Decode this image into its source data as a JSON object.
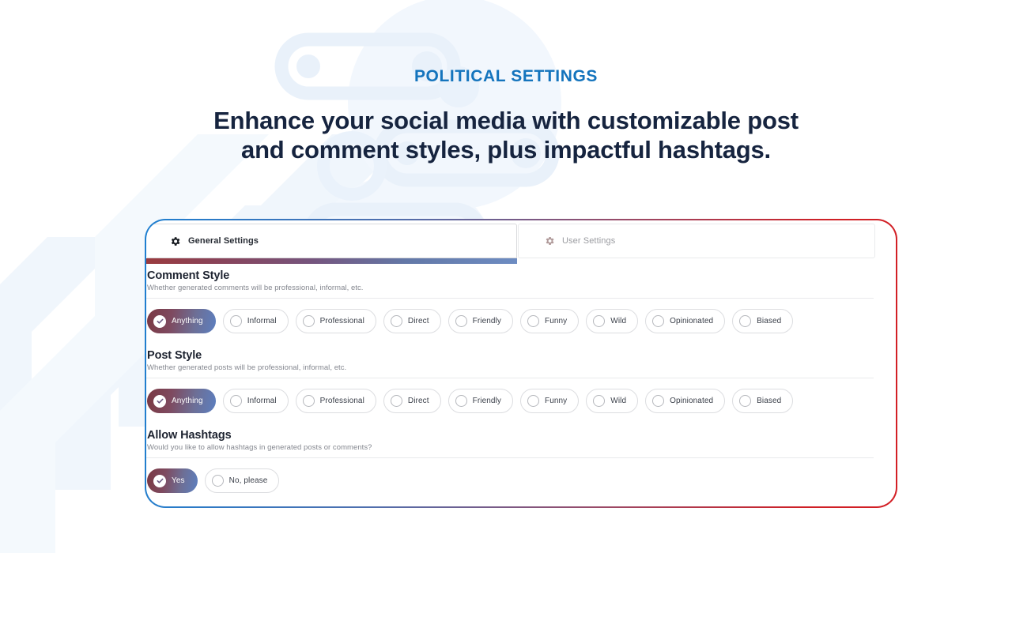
{
  "header": {
    "eyebrow": "POLITICAL SETTINGS",
    "headline_line1": "Enhance your social media with customizable post",
    "headline_line2": "and comment styles, plus impactful hashtags.",
    "eyebrow_color": "#1474bd",
    "headline_color": "#16243f"
  },
  "card": {
    "border_gradient_from": "#1e7fd0",
    "border_gradient_to": "#d31f25"
  },
  "tabs": [
    {
      "label": "General Settings",
      "icon": "gear-icon",
      "active": true
    },
    {
      "label": "User Settings",
      "icon": "gear-icon",
      "active": false
    }
  ],
  "sections": [
    {
      "key": "comment_style",
      "title": "Comment Style",
      "subtitle": "Whether generated comments will be professional, informal, etc.",
      "options": [
        {
          "label": "Anything",
          "selected": true
        },
        {
          "label": "Informal",
          "selected": false
        },
        {
          "label": "Professional",
          "selected": false
        },
        {
          "label": "Direct",
          "selected": false
        },
        {
          "label": "Friendly",
          "selected": false
        },
        {
          "label": "Funny",
          "selected": false
        },
        {
          "label": "Wild",
          "selected": false
        },
        {
          "label": "Opinionated",
          "selected": false
        },
        {
          "label": "Biased",
          "selected": false
        }
      ]
    },
    {
      "key": "post_style",
      "title": "Post Style",
      "subtitle": "Whether generated posts will be professional, informal, etc.",
      "options": [
        {
          "label": "Anything",
          "selected": true
        },
        {
          "label": "Informal",
          "selected": false
        },
        {
          "label": "Professional",
          "selected": false
        },
        {
          "label": "Direct",
          "selected": false
        },
        {
          "label": "Friendly",
          "selected": false
        },
        {
          "label": "Funny",
          "selected": false
        },
        {
          "label": "Wild",
          "selected": false
        },
        {
          "label": "Opinionated",
          "selected": false
        },
        {
          "label": "Biased",
          "selected": false
        }
      ]
    },
    {
      "key": "allow_hashtags",
      "title": "Allow Hashtags",
      "subtitle": "Would you like to allow hashtags in generated posts or comments?",
      "options": [
        {
          "label": "Yes",
          "selected": true
        },
        {
          "label": "No, please",
          "selected": false
        }
      ]
    }
  ],
  "selected_pill_gradient": {
    "from": "#7a3842",
    "to": "#5c7fc0"
  },
  "background": {
    "watermark_color": "#eaf2fb"
  }
}
